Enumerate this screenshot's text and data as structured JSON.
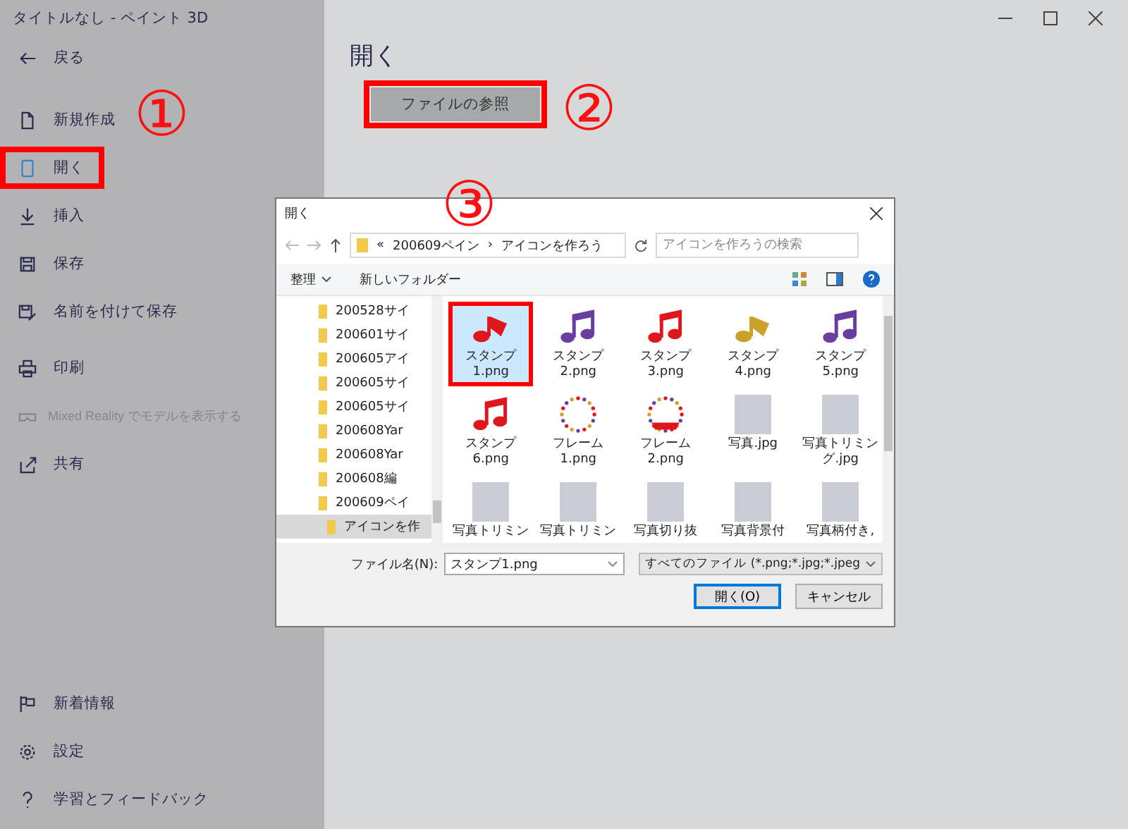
{
  "window": {
    "title": "タイトルなし - ペイント 3D"
  },
  "sidebar": {
    "back": {
      "label": "戻る"
    },
    "groups": [
      [
        {
          "label": "新規作成",
          "kind": "new",
          "highlighted": false,
          "disabled": false
        },
        {
          "label": "開く",
          "kind": "open",
          "highlighted": true,
          "disabled": false
        },
        {
          "label": "挿入",
          "kind": "insert",
          "highlighted": false,
          "disabled": false
        },
        {
          "label": "保存",
          "kind": "save",
          "highlighted": false,
          "disabled": false
        },
        {
          "label": "名前を付けて保存",
          "kind": "saveas",
          "highlighted": false,
          "disabled": false
        }
      ],
      [
        {
          "label": "印刷",
          "kind": "print",
          "highlighted": false,
          "disabled": false
        },
        {
          "label": "Mixed Reality でモデルを表示する",
          "kind": "mr",
          "highlighted": false,
          "disabled": true
        },
        {
          "label": "共有",
          "kind": "share",
          "highlighted": false,
          "disabled": false
        }
      ]
    ],
    "footer": [
      {
        "label": "新着情報",
        "kind": "news"
      },
      {
        "label": "設定",
        "kind": "settings"
      },
      {
        "label": "学習とフィードバック",
        "kind": "help"
      }
    ]
  },
  "main": {
    "heading": "開く",
    "browse_button": {
      "label": "ファイルの参照",
      "highlighted": true
    }
  },
  "annotations": [
    {
      "label": "①"
    },
    {
      "label": "②"
    },
    {
      "label": "③"
    }
  ],
  "dialog": {
    "title": "開く",
    "address": {
      "overflow": "«",
      "parts": [
        "200609ペイン",
        "アイコンを作ろう"
      ],
      "separator": "›"
    },
    "search": {
      "placeholder": "アイコンを作ろうの検索"
    },
    "toolbar": {
      "organize": "整理",
      "new_folder": "新しいフォルダー"
    },
    "folders": [
      {
        "label": "200528サイ",
        "selected": false
      },
      {
        "label": "200601サイ",
        "selected": false
      },
      {
        "label": "200605アイ",
        "selected": false
      },
      {
        "label": "200605サイ",
        "selected": false
      },
      {
        "label": "200605サイ",
        "selected": false
      },
      {
        "label": "200608Yar",
        "selected": false
      },
      {
        "label": "200608Yar",
        "selected": false
      },
      {
        "label": "200608編",
        "selected": false
      },
      {
        "label": "200609ペイ",
        "selected": false,
        "children": [
          {
            "label": "アイコンを作",
            "selected": true
          }
        ]
      }
    ],
    "files": [
      {
        "name_lines": [
          "スタンプ",
          "1.png"
        ],
        "kind": "note",
        "color": "#e0161e",
        "selected": true,
        "highlighted": true
      },
      {
        "name_lines": [
          "スタンプ",
          "2.png"
        ],
        "kind": "notes",
        "color": "#6a3ea0",
        "selected": false,
        "highlighted": false
      },
      {
        "name_lines": [
          "スタンプ",
          "3.png"
        ],
        "kind": "notes",
        "color": "#e0161e",
        "selected": false,
        "highlighted": false
      },
      {
        "name_lines": [
          "スタンプ",
          "4.png"
        ],
        "kind": "note",
        "color": "#c9a227",
        "selected": false,
        "highlighted": false
      },
      {
        "name_lines": [
          "スタンプ",
          "5.png"
        ],
        "kind": "notes",
        "color": "#6a3ea0",
        "selected": false,
        "highlighted": false
      },
      {
        "name_lines": [
          "スタンプ",
          "6.png"
        ],
        "kind": "notes",
        "color": "#e0161e",
        "selected": false,
        "highlighted": false
      },
      {
        "name_lines": [
          "フレーム",
          "1.png"
        ],
        "kind": "frame",
        "selected": false,
        "highlighted": false
      },
      {
        "name_lines": [
          "フレーム",
          "2.png"
        ],
        "kind": "frame-banner",
        "selected": false,
        "highlighted": false
      },
      {
        "name_lines": [
          "写真.jpg"
        ],
        "kind": "photo",
        "selected": false,
        "highlighted": false
      },
      {
        "name_lines": [
          "写真トリミン",
          "グ.jpg"
        ],
        "kind": "photo",
        "selected": false,
        "highlighted": false
      },
      {
        "name_lines": [
          "写真トリミン"
        ],
        "kind": "photo",
        "selected": false,
        "highlighted": false
      },
      {
        "name_lines": [
          "写真トリミン"
        ],
        "kind": "photo",
        "selected": false,
        "highlighted": false
      },
      {
        "name_lines": [
          "写真切り抜"
        ],
        "kind": "photo",
        "selected": false,
        "highlighted": false
      },
      {
        "name_lines": [
          "写真背景付"
        ],
        "kind": "photo",
        "selected": false,
        "highlighted": false
      },
      {
        "name_lines": [
          "写真柄付き,"
        ],
        "kind": "photo",
        "selected": false,
        "highlighted": false
      }
    ],
    "filename_label": "ファイル名(N):",
    "filename": "スタンプ1.png",
    "filter": "すべてのファイル (*.png;*.jpg;*.jpeg",
    "buttons": [
      {
        "label": "開く(O)",
        "default": true
      },
      {
        "label": "キャンセル",
        "default": false
      }
    ]
  }
}
